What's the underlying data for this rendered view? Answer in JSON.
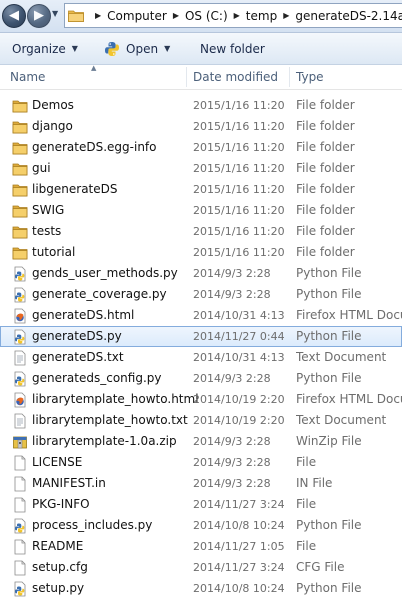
{
  "address": {
    "crumbs": [
      "Computer",
      "OS (C:)",
      "temp",
      "generateDS-2.14a"
    ]
  },
  "toolbar": {
    "organize_label": "Organize",
    "open_label": "Open",
    "newfolder_label": "New folder"
  },
  "columns": {
    "name": "Name",
    "date": "Date modified",
    "type": "Type"
  },
  "files": [
    {
      "name": "Demos",
      "date": "2015/1/16 11:20",
      "type": "File folder",
      "icon": "folder-icon"
    },
    {
      "name": "django",
      "date": "2015/1/16 11:20",
      "type": "File folder",
      "icon": "folder-icon"
    },
    {
      "name": "generateDS.egg-info",
      "date": "2015/1/16 11:20",
      "type": "File folder",
      "icon": "folder-icon"
    },
    {
      "name": "gui",
      "date": "2015/1/16 11:20",
      "type": "File folder",
      "icon": "folder-icon"
    },
    {
      "name": "libgenerateDS",
      "date": "2015/1/16 11:20",
      "type": "File folder",
      "icon": "folder-icon"
    },
    {
      "name": "SWIG",
      "date": "2015/1/16 11:20",
      "type": "File folder",
      "icon": "folder-icon"
    },
    {
      "name": "tests",
      "date": "2015/1/16 11:20",
      "type": "File folder",
      "icon": "folder-icon"
    },
    {
      "name": "tutorial",
      "date": "2015/1/16 11:20",
      "type": "File folder",
      "icon": "folder-icon"
    },
    {
      "name": "gends_user_methods.py",
      "date": "2014/9/3 2:28",
      "type": "Python File",
      "icon": "python-file-icon"
    },
    {
      "name": "generate_coverage.py",
      "date": "2014/9/3 2:28",
      "type": "Python File",
      "icon": "python-file-icon"
    },
    {
      "name": "generateDS.html",
      "date": "2014/10/31 4:13",
      "type": "Firefox HTML Document",
      "icon": "html-file-icon"
    },
    {
      "name": "generateDS.py",
      "date": "2014/11/27 0:44",
      "type": "Python File",
      "icon": "python-file-icon",
      "selected": true
    },
    {
      "name": "generateDS.txt",
      "date": "2014/10/31 4:13",
      "type": "Text Document",
      "icon": "text-file-icon"
    },
    {
      "name": "generateds_config.py",
      "date": "2014/9/3 2:28",
      "type": "Python File",
      "icon": "python-file-icon"
    },
    {
      "name": "librarytemplate_howto.html",
      "date": "2014/10/19 2:20",
      "type": "Firefox HTML Document",
      "icon": "html-file-icon"
    },
    {
      "name": "librarytemplate_howto.txt",
      "date": "2014/10/19 2:20",
      "type": "Text Document",
      "icon": "text-file-icon"
    },
    {
      "name": "librarytemplate-1.0a.zip",
      "date": "2014/9/3 2:28",
      "type": "WinZip File",
      "icon": "zip-file-icon"
    },
    {
      "name": "LICENSE",
      "date": "2014/9/3 2:28",
      "type": "File",
      "icon": "blank-file-icon"
    },
    {
      "name": "MANIFEST.in",
      "date": "2014/9/3 2:28",
      "type": "IN File",
      "icon": "blank-file-icon"
    },
    {
      "name": "PKG-INFO",
      "date": "2014/11/27 3:24",
      "type": "File",
      "icon": "blank-file-icon"
    },
    {
      "name": "process_includes.py",
      "date": "2014/10/8 10:24",
      "type": "Python File",
      "icon": "python-file-icon"
    },
    {
      "name": "README",
      "date": "2014/11/27 1:05",
      "type": "File",
      "icon": "blank-file-icon"
    },
    {
      "name": "setup.cfg",
      "date": "2014/11/27 3:24",
      "type": "CFG File",
      "icon": "blank-file-icon"
    },
    {
      "name": "setup.py",
      "date": "2014/10/8 10:24",
      "type": "Python File",
      "icon": "python-file-icon"
    }
  ]
}
